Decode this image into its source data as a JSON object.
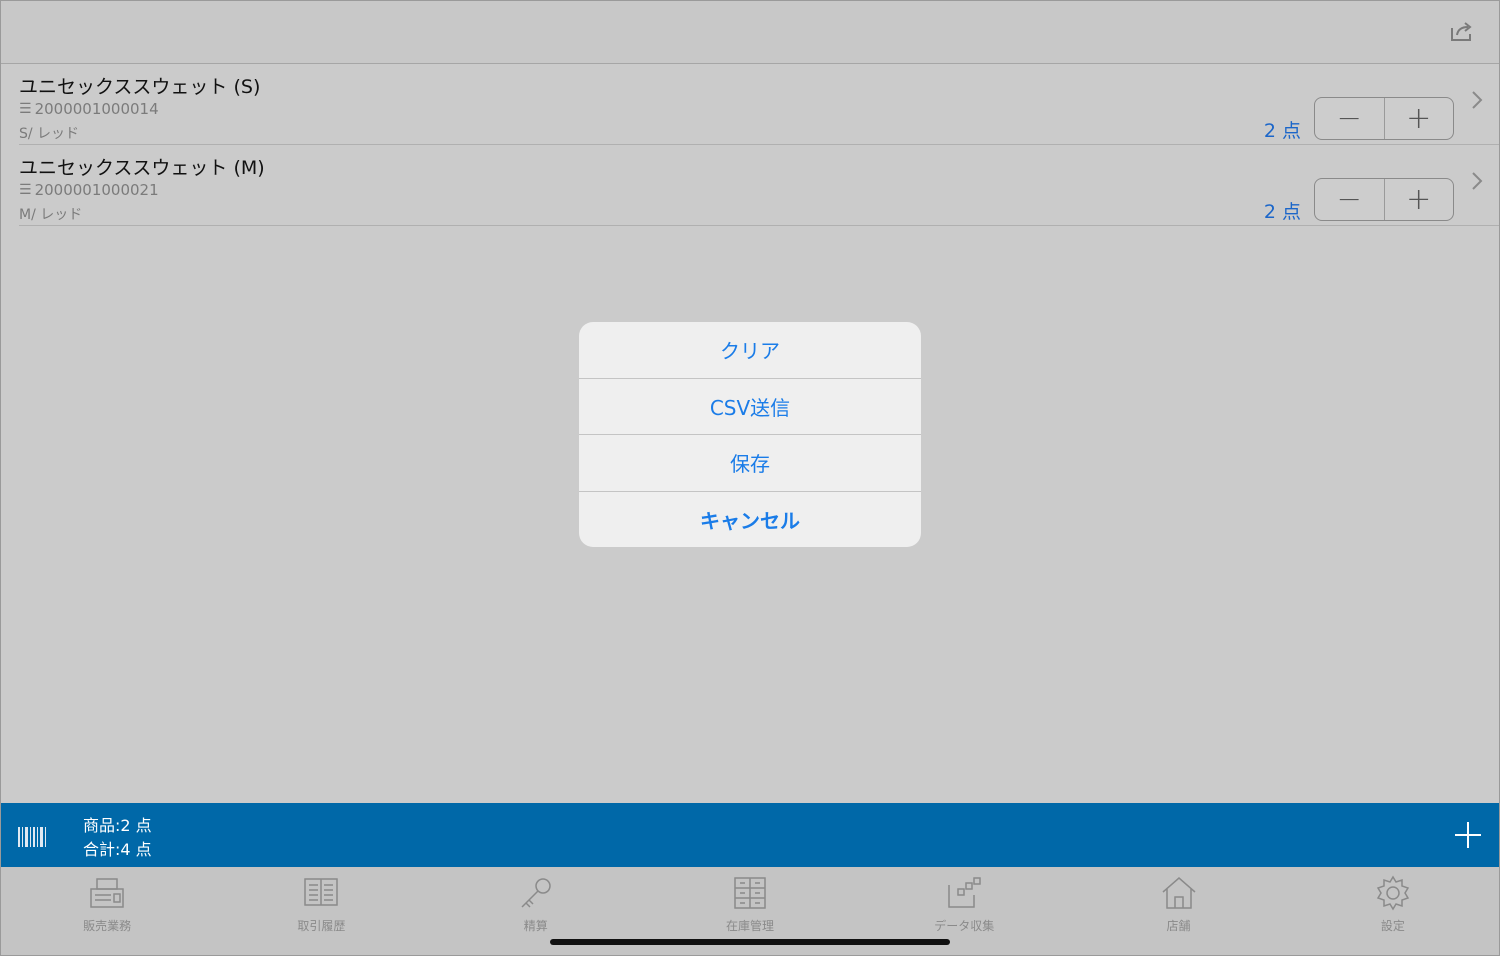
{
  "products": [
    {
      "name": "ユニセックススウェット (S)",
      "barcode": "2000001000014",
      "variant": "S/ レッド",
      "qty": "2 点"
    },
    {
      "name": "ユニセックススウェット (M)",
      "barcode": "2000001000021",
      "variant": "M/ レッド",
      "qty": "2 点"
    }
  ],
  "stepper": {
    "minus": "−",
    "plus": "+"
  },
  "action_sheet": {
    "items": [
      "クリア",
      "CSV送信",
      "保存"
    ],
    "cancel": "キャンセル"
  },
  "summary": {
    "items": "商品:2 点",
    "total": "合計:4 点"
  },
  "tabs": [
    {
      "label": "販売業務",
      "icon": "register-icon"
    },
    {
      "label": "取引履歴",
      "icon": "ledger-icon"
    },
    {
      "label": "精算",
      "icon": "key-icon"
    },
    {
      "label": "在庫管理",
      "icon": "inventory-icon"
    },
    {
      "label": "データ収集",
      "icon": "data-collection-icon"
    },
    {
      "label": "店舗",
      "icon": "store-icon"
    },
    {
      "label": "設定",
      "icon": "gear-icon"
    }
  ],
  "colors": {
    "accent": "#1a7ce8",
    "bar": "#0068a8"
  }
}
